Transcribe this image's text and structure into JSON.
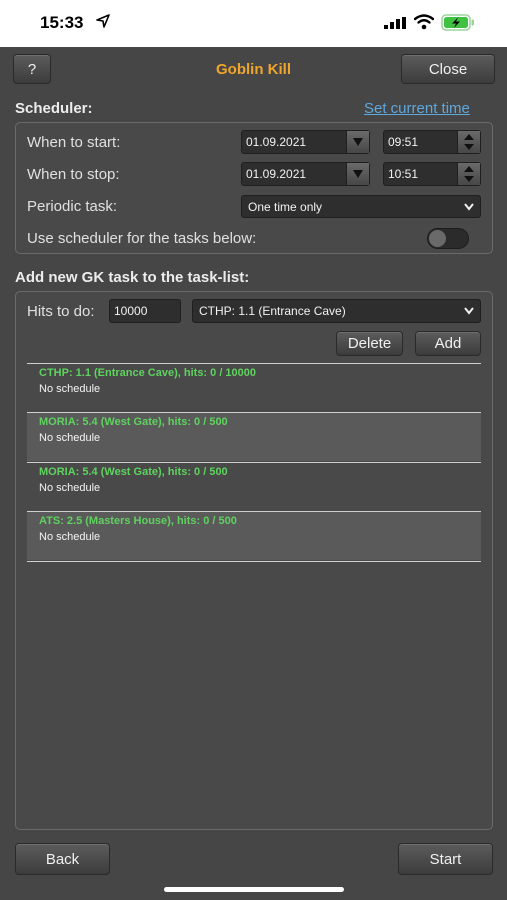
{
  "status_bar": {
    "time": "15:33"
  },
  "header": {
    "help_label": "?",
    "title": "Goblin Kill",
    "close_label": "Close"
  },
  "scheduler": {
    "heading": "Scheduler:",
    "set_time_link": "Set current time",
    "start_label": "When to start:",
    "start_date": "01.09.2021",
    "start_time": "09:51",
    "stop_label": "When to stop:",
    "stop_date": "01.09.2021",
    "stop_time": "10:51",
    "periodic_label": "Periodic task:",
    "periodic_value": "One time only",
    "use_scheduler_label": "Use scheduler for the tasks below:",
    "use_scheduler_on": false
  },
  "add_task": {
    "heading": "Add new GK task to the task-list:",
    "hits_label": "Hits to do:",
    "hits_value": "10000",
    "location_value": "CTHP: 1.1 (Entrance Cave)",
    "delete_label": "Delete",
    "add_label": "Add"
  },
  "tasks": [
    {
      "name": "CTHP: 1.1 (Entrance Cave), hits: 0 / 10000",
      "schedule": "No schedule"
    },
    {
      "name": "MORIA: 5.4 (West Gate), hits: 0 / 500",
      "schedule": "No schedule"
    },
    {
      "name": "MORIA: 5.4 (West Gate), hits: 0 / 500",
      "schedule": "No schedule"
    },
    {
      "name": "ATS: 2.5 (Masters House), hits: 0 / 500",
      "schedule": "No schedule"
    }
  ],
  "footer": {
    "back_label": "Back",
    "start_label": "Start"
  },
  "colors": {
    "accent_title": "#f0a52c",
    "link": "#5fa8dc",
    "task_name": "#5fd25f",
    "background": "#464646"
  }
}
